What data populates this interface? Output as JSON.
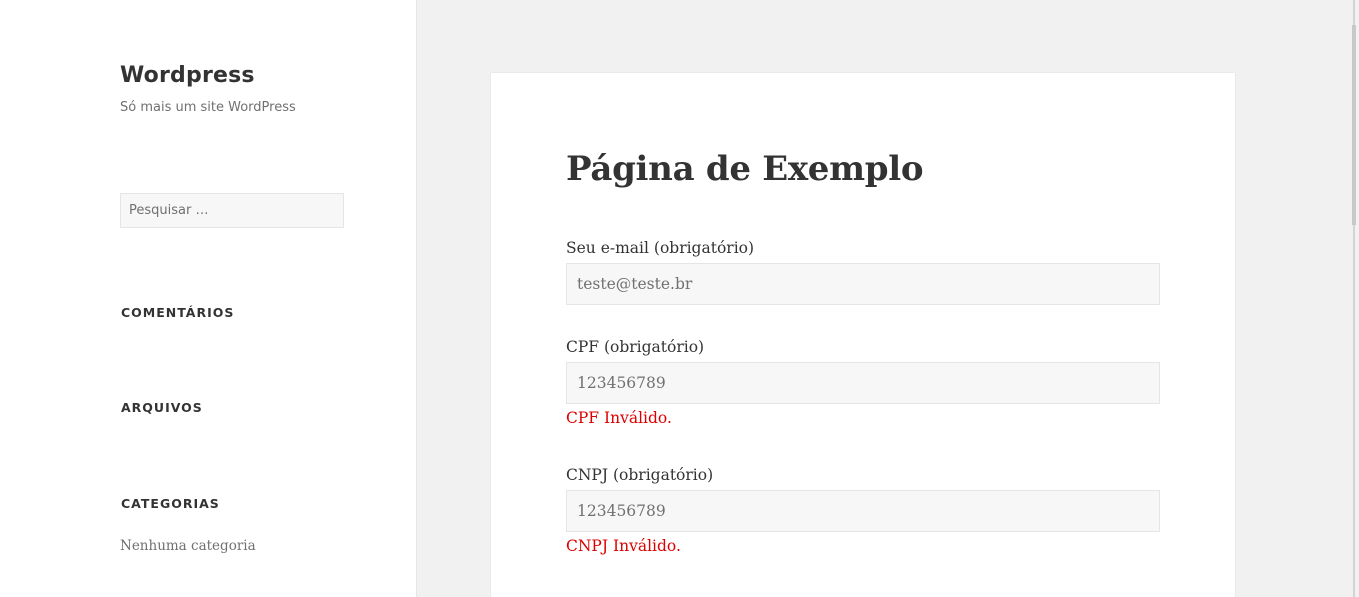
{
  "site": {
    "title": "Wordpress",
    "description": "Só mais um site WordPress"
  },
  "search": {
    "placeholder": "Pesquisar …",
    "value": ""
  },
  "widgets": {
    "comments_title": "COMENTÁRIOS",
    "archives_title": "ARQUIVOS",
    "categories_title": "CATEGORIAS",
    "categories_empty": "Nenhuma categoria"
  },
  "page": {
    "title": "Página de Exemplo"
  },
  "form": {
    "email": {
      "label": "Seu e-mail (obrigatório)",
      "value": "teste@teste.br"
    },
    "cpf": {
      "label": "CPF (obrigatório)",
      "value": "123456789",
      "error": "CPF Inválido."
    },
    "cnpj": {
      "label": "CNPJ (obrigatório)",
      "value": "123456789",
      "error": "CNPJ Inválido."
    }
  },
  "colors": {
    "sidebar_bg": "#ffffff",
    "page_bg": "#f1f1f1",
    "text": "#333333",
    "muted": "#707070",
    "error": "#dd0000",
    "input_bg": "#f7f7f7",
    "border": "#e5e5e5"
  }
}
